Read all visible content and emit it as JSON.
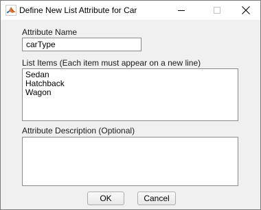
{
  "window": {
    "title": "Define New List Attribute for Car",
    "app_icon": "matlab-icon"
  },
  "attribute_name": {
    "label": "Attribute Name",
    "value": "carType"
  },
  "list_items": {
    "label": "List Items (Each item must appear on a new line)",
    "items": [
      "Sedan",
      "Hatchback",
      "Wagon"
    ]
  },
  "description": {
    "label": "Attribute Description (Optional)",
    "value": ""
  },
  "buttons": {
    "ok": "OK",
    "cancel": "Cancel"
  }
}
